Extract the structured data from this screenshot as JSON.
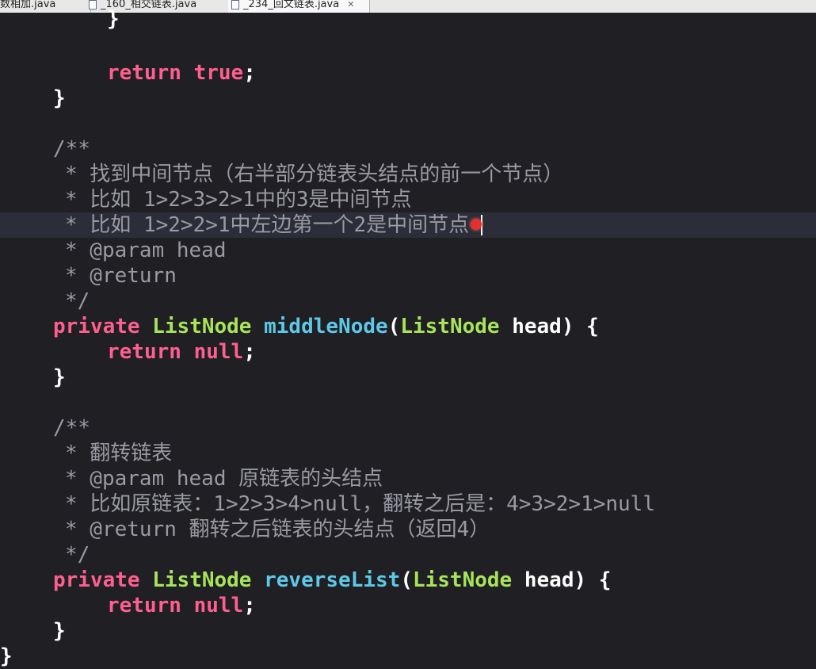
{
  "tabs": [
    {
      "label": "数相加.java"
    },
    {
      "label": "_160_相交链表.java"
    },
    {
      "label": "_234_回文链表.java",
      "close": "✕"
    }
  ],
  "code": {
    "l1": "}",
    "l2_kw": "return",
    "l2_val": "true",
    "l2_semi": ";",
    "l3": "}",
    "c1_open": "/**",
    "c1_line1": "* 找到中间节点（右半部分链表头结点的前一个节点）",
    "c1_line2": "* 比如 1>2>3>2>1中的3是中间节点",
    "c1_line3": "* 比如 1>2>2>1中左边第一个2是中间节点",
    "c1_param": "* @param head",
    "c1_return": "* @return",
    "c1_close": "*/",
    "m1_private": "private",
    "m1_type": "ListNode",
    "m1_name": "middleNode",
    "m1_paren": "(",
    "m1_ptype": "ListNode",
    "m1_rest": " head) {",
    "m1_ret_kw": "return",
    "m1_ret_val": "null",
    "m1_semi": ";",
    "m1_close": "}",
    "c2_open": "/**",
    "c2_line1": "* 翻转链表",
    "c2_param": "* @param head 原链表的头结点",
    "c2_example": "* 比如原链表：1>2>3>4>null，翻转之后是：4>3>2>1>null",
    "c2_return": "* @return 翻转之后链表的头结点（返回4）",
    "c2_close": "*/",
    "m2_private": "private",
    "m2_type": "ListNode",
    "m2_name": "reverseList",
    "m2_paren": "(",
    "m2_ptype": "ListNode",
    "m2_rest": " head) {",
    "m2_ret_kw": "return",
    "m2_ret_val": "null",
    "m2_semi": ";",
    "m2_close": "}",
    "class_close": "}"
  },
  "colors": {
    "keyword": "#ff5f8e",
    "type": "#a8e45a",
    "method": "#5ec9e6",
    "comment": "#9a9aa3",
    "plain": "#ffffff",
    "background": "#1f1f24",
    "current_line": "#2b2d38"
  }
}
